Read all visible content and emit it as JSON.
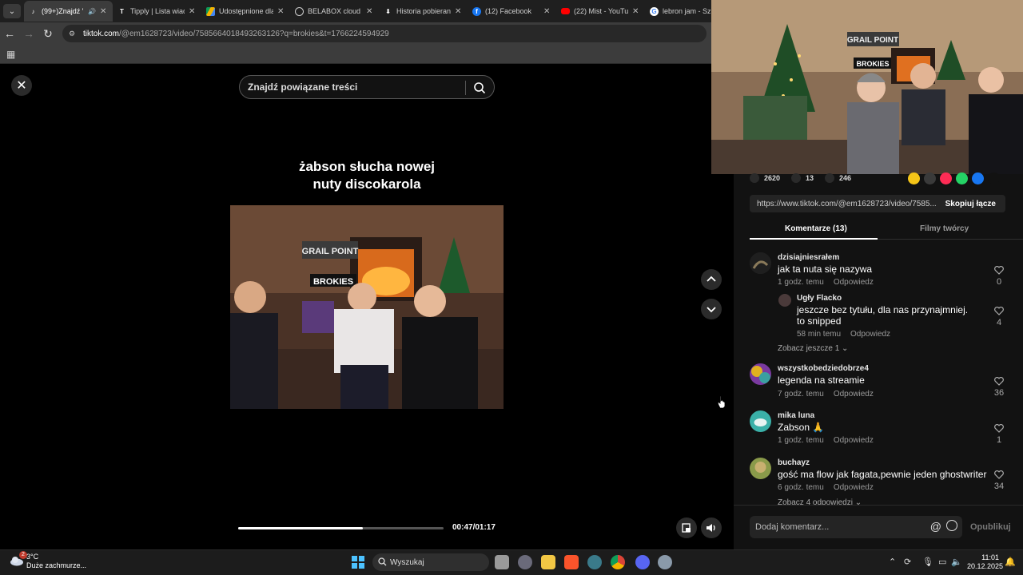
{
  "browser": {
    "tabs": [
      {
        "title": "(99+)Znajdź 'l",
        "active": true,
        "audio": true
      },
      {
        "title": "Tipply | Lista wiad"
      },
      {
        "title": "Udostępnione dla"
      },
      {
        "title": "BELABOX cloud"
      },
      {
        "title": "Historia pobieran"
      },
      {
        "title": "(12) Facebook"
      },
      {
        "title": "(22) Mist - YouTu"
      },
      {
        "title": "lebron jam - Szuk"
      }
    ],
    "url_host": "tiktok.com",
    "url_path": "/@em1628723/video/7585664018493263126?q=brokies&t=1766224594929"
  },
  "video": {
    "search_placeholder": "Znajdź powiązane treści",
    "caption_line1": "żabson słucha nowej",
    "caption_line2": "nuty discokarola",
    "frame_sign1": "GRAIL POINT",
    "frame_sign2": "BROKIES",
    "progress": 0.607,
    "timecode": "00:47/01:17"
  },
  "webcam": {
    "sign1": "GRAIL POINT",
    "sign2": "BROKIES"
  },
  "panel": {
    "likes": "2620",
    "comments_count": "13",
    "saves": "246",
    "share_link": "https://www.tiktok.com/@em1628723/video/7585...",
    "copy_label": "Skopiuj łącze",
    "tab_comments": "Komentarze (13)",
    "tab_creator": "Filmy twórcy",
    "reply_label": "Odpowiedz",
    "comments": [
      {
        "user": "dzisiajniesrałem",
        "text": "jak ta nuta się nazywa",
        "time": "1 godz. temu",
        "likes": "0"
      },
      {
        "user": "Ugły Flacko",
        "text": "jeszcze bez tytułu, dla nas przynajmniej. to snipped",
        "time": "58 min temu",
        "likes": "4"
      },
      {
        "user": "wszystkobedziedobrze4",
        "text": "legenda na streamie",
        "time": "7 godz. temu",
        "likes": "36"
      },
      {
        "user": "mika luna",
        "text": "Zabson 🙏",
        "time": "1 godz. temu",
        "likes": "1"
      },
      {
        "user": "buchayz",
        "text": "gość ma flow jak fagata,pewnie jeden ghostwriter",
        "time": "6 godz. temu",
        "likes": "34"
      }
    ],
    "see_more_1": "Zobacz jeszcze 1",
    "see_more_4": "Zobacz 4 odpowiedzi",
    "add_comment_placeholder": "Dodaj komentarz...",
    "post_label": "Opublikuj"
  },
  "taskbar": {
    "temp": "3°C",
    "weather": "Duże zachmurze...",
    "weather_badge": "2",
    "search": "Wyszukaj",
    "time": "11:01",
    "date": "20.12.2025"
  }
}
